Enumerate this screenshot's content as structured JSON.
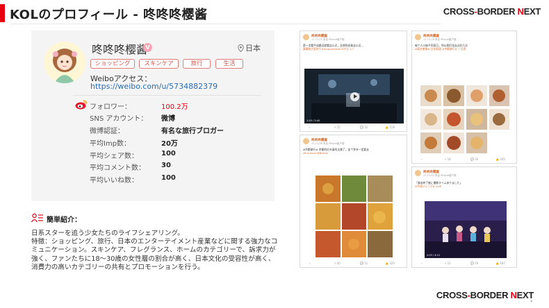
{
  "page": {
    "title": "KOLのプロフィール - 咚咚咚樱酱",
    "brand_left": "CROSS",
    "brand_dash": "-",
    "brand_mid": "BORDER ",
    "brand_n": "N",
    "brand_right": "EXT",
    "page_number": "4",
    "accent_color": "#e60012"
  },
  "profile": {
    "name": "咚咚咚樱酱",
    "location": "日本",
    "tags": [
      "ショッピング",
      "スキンケア",
      "旅行",
      "生活"
    ],
    "weibo_label": "Weiboアクセス：",
    "weibo_url": "https://weibo.com/u/5734882379",
    "stats": [
      {
        "label": "フォロワー：",
        "value": "100.2万"
      },
      {
        "label": "SNS アカウント：",
        "value": "微博"
      },
      {
        "label": "微博認証：",
        "value": "有名な旅行ブロガー"
      },
      {
        "label": "平均Imp数：",
        "value": "20万"
      },
      {
        "label": "平均シェア数：",
        "value": "100"
      },
      {
        "label": "平均コメント数：",
        "value": "30"
      },
      {
        "label": "平均いいね数：",
        "value": "100"
      }
    ]
  },
  "intro": {
    "title": "簡単紹介：",
    "line1": "日系スターを追う少女たちのライフシェアリング。",
    "line2": "特徴：ショッピング、旅行、日本のエンターテイメント産業などに関する強力なコミュニケーション。スキンケア、フレグランス、ホームのカテゴリーで、訴求力が強く、ファンたちに18～30歳の女性層の割合が高く、日本文化の受容性が高く、消費力の高いカテゴリーの共有とプロモーションを行う。"
  },
  "posts": [
    {
      "name": "咚咚咚樱酱",
      "meta": "17-11-21 来自 iPhone客户端",
      "text1": "第一次看平成跳远就看这么近，没想到还能这么近…",
      "text2": "赛事和大阪的ワ#hiraparkee#CDデビュー",
      "video_time": "1:10 / 3:40",
      "footer": [
        "☆",
        "↗ 25",
        "💬 32",
        "👍 218"
      ]
    },
    {
      "name": "咚咚咚樱酱",
      "meta": "17-11-18 来自 iPhone客户端",
      "text1": "每个人口味不同而已，所以我们也去过好几次",
      "text2": "#東京美食# 日本料理 #京都旅行# 一日游",
      "footer": [
        "☆",
        "↗ 18",
        "💬 26",
        "👍 205"
      ]
    },
    {
      "name": "咚咚咚樱酱",
      "meta": "17-11-08 来自 iPhone客户端",
      "text1": "#京都旅行# 京都的红叶真的太美了，这个季节一定要去",
      "text2": "#hirukirai @Bambi",
      "footer": [
        "☆",
        "↗ 40",
        "💬 51",
        "👍 326"
      ]
    },
    {
      "name": "咚咚咚樱酱",
      "meta": "17-11-02 来自 iPhone客户端",
      "text1": "「演出終了後に撮影タイムありました」",
      "text2": "#平成ジャンプ# LIVE",
      "video_time": "2:03 / 4:12",
      "footer": [
        "☆",
        "↗ 22",
        "💬 19",
        "👍 187"
      ]
    }
  ]
}
